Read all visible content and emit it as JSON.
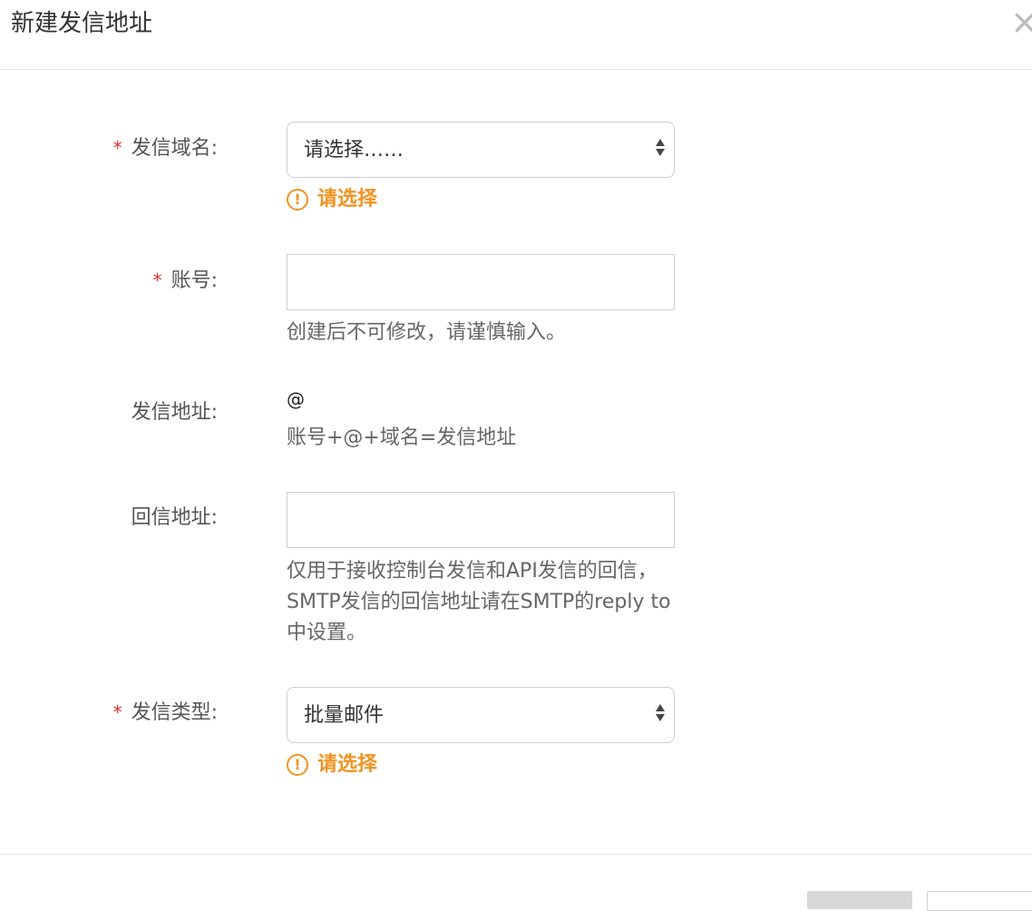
{
  "dialog": {
    "title": "新建发信地址",
    "close_icon": "×"
  },
  "form": {
    "domain": {
      "required_mark": "*",
      "label": "发信域名:",
      "selected": "请选择……",
      "warning": "请选择"
    },
    "account": {
      "required_mark": "*",
      "label": "账号:",
      "value": "",
      "help": "创建后不可修改，请谨慎输入。"
    },
    "sender_address": {
      "label": "发信地址:",
      "value": "@",
      "help": "账号+@+域名=发信地址"
    },
    "reply_address": {
      "label": "回信地址:",
      "value": "",
      "help": "仅用于接收控制台发信和API发信的回信，SMTP发信的回信地址请在SMTP的reply to中设置。"
    },
    "send_type": {
      "required_mark": "*",
      "label": "发信类型:",
      "selected": "批量邮件",
      "warning": "请选择"
    }
  },
  "footer": {
    "confirm_label": "",
    "cancel_label": ""
  },
  "colors": {
    "required": "#e0302b",
    "warning": "#f29320",
    "border": "#cfcfcf"
  }
}
